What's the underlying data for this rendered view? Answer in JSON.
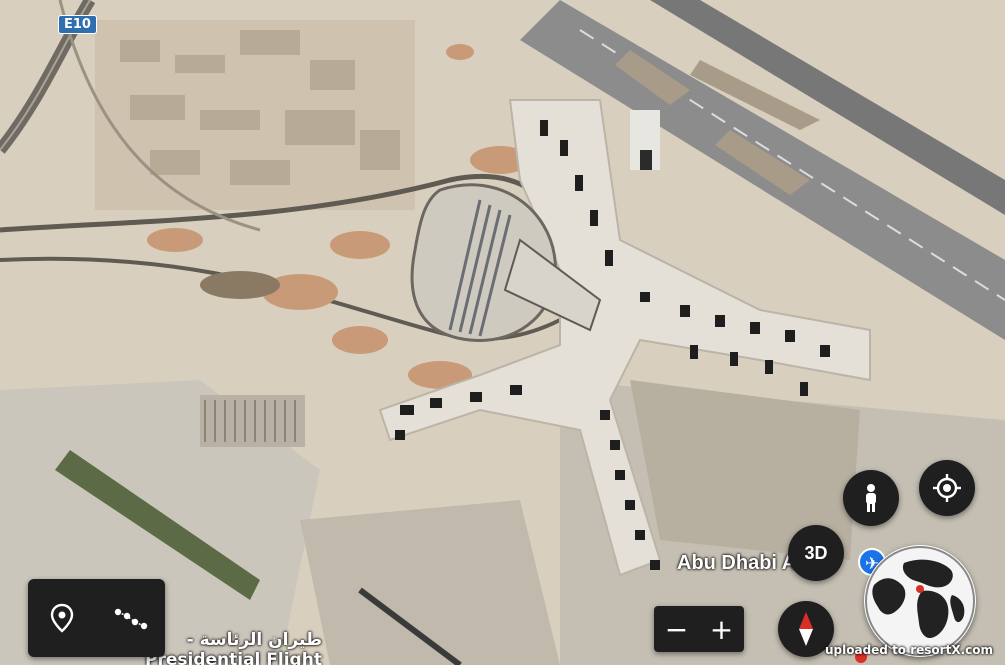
{
  "map": {
    "view": "satellite",
    "road_shield": "E10",
    "place_label": "Abu Dhabi A",
    "airport_icon": "airplane-icon",
    "poi_label_line1": "- طيران الرئاسة",
    "poi_label_line2": "Presidential Flight"
  },
  "controls": {
    "pegman_icon": "pegman-icon",
    "my_location_icon": "my-location-icon",
    "three_d_label": "3D",
    "compass_icon": "compass-icon",
    "zoom_out_label": "−",
    "zoom_in_label": "+",
    "pin_icon": "place-pin-icon",
    "route_icon": "route-icon"
  },
  "globe": {
    "icon": "globe-icon"
  },
  "watermark": "uploaded to resortX.com",
  "colors": {
    "sand": "#d9cfbf",
    "runway": "#8c8c8c",
    "terminal": "#e4e0d8",
    "control_bg": "#1f1f1f",
    "accent_blue": "#1a73e8",
    "compass_red": "#d93025"
  }
}
